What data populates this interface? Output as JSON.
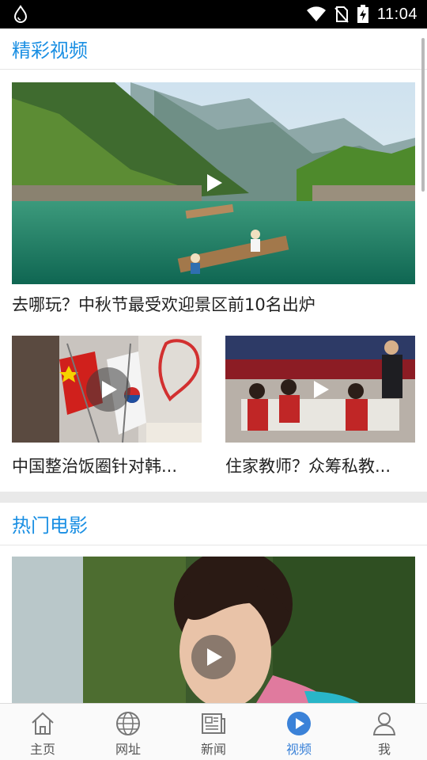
{
  "status_bar": {
    "time": "11:04",
    "icons": [
      "water-drop-icon",
      "wifi-icon",
      "no-sim-icon",
      "battery-charging-icon"
    ]
  },
  "sections": {
    "featured": {
      "title": "精彩视频",
      "main_video": {
        "caption": "去哪玩？中秋节最受欢迎景区前10名出炉"
      },
      "small_videos": [
        {
          "caption": "中国整治饭圈针对韩..."
        },
        {
          "caption": "住家教师？众筹私教..."
        }
      ]
    },
    "movies": {
      "title": "热门电影"
    }
  },
  "bottom_nav": {
    "items": [
      {
        "label": "主页",
        "icon": "home-icon"
      },
      {
        "label": "网址",
        "icon": "globe-icon"
      },
      {
        "label": "新闻",
        "icon": "newspaper-icon"
      },
      {
        "label": "视频",
        "icon": "play-circle-icon",
        "active": true
      },
      {
        "label": "我",
        "icon": "person-icon"
      }
    ]
  },
  "colors": {
    "accent": "#1a8fe3",
    "nav_active": "#3b82d8"
  }
}
